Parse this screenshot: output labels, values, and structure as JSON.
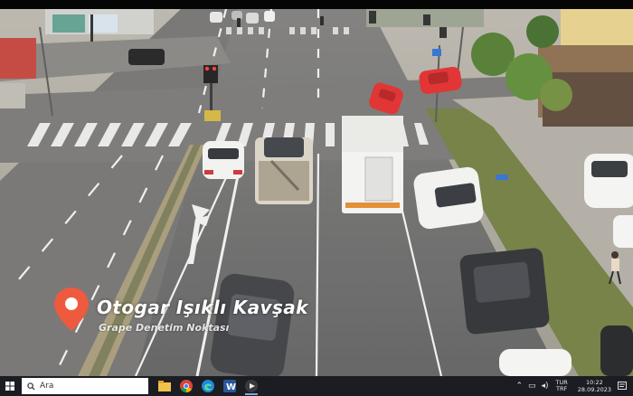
{
  "overlay": {
    "title": "Otogar Işıklı Kavşak",
    "subtitle": "Grape Denetim Noktası",
    "pin_color": "#ee5a3d"
  },
  "taskbar": {
    "search_placeholder": "Ara",
    "apps": [
      {
        "name": "file-explorer-icon"
      },
      {
        "name": "chrome-icon"
      },
      {
        "name": "edge-icon"
      },
      {
        "name": "word-icon"
      },
      {
        "name": "media-player-icon"
      }
    ],
    "tray": {
      "language_line1": "TUR",
      "language_line2": "TRF",
      "time": "10:22",
      "date": "28.09.2023"
    }
  },
  "colors": {
    "asphalt": "#6f6f6f",
    "sidewalk": "#a8a49b",
    "grass": "#6c7a3a",
    "red_car": "#e12a2a",
    "taskbar": "#1b1d22"
  }
}
